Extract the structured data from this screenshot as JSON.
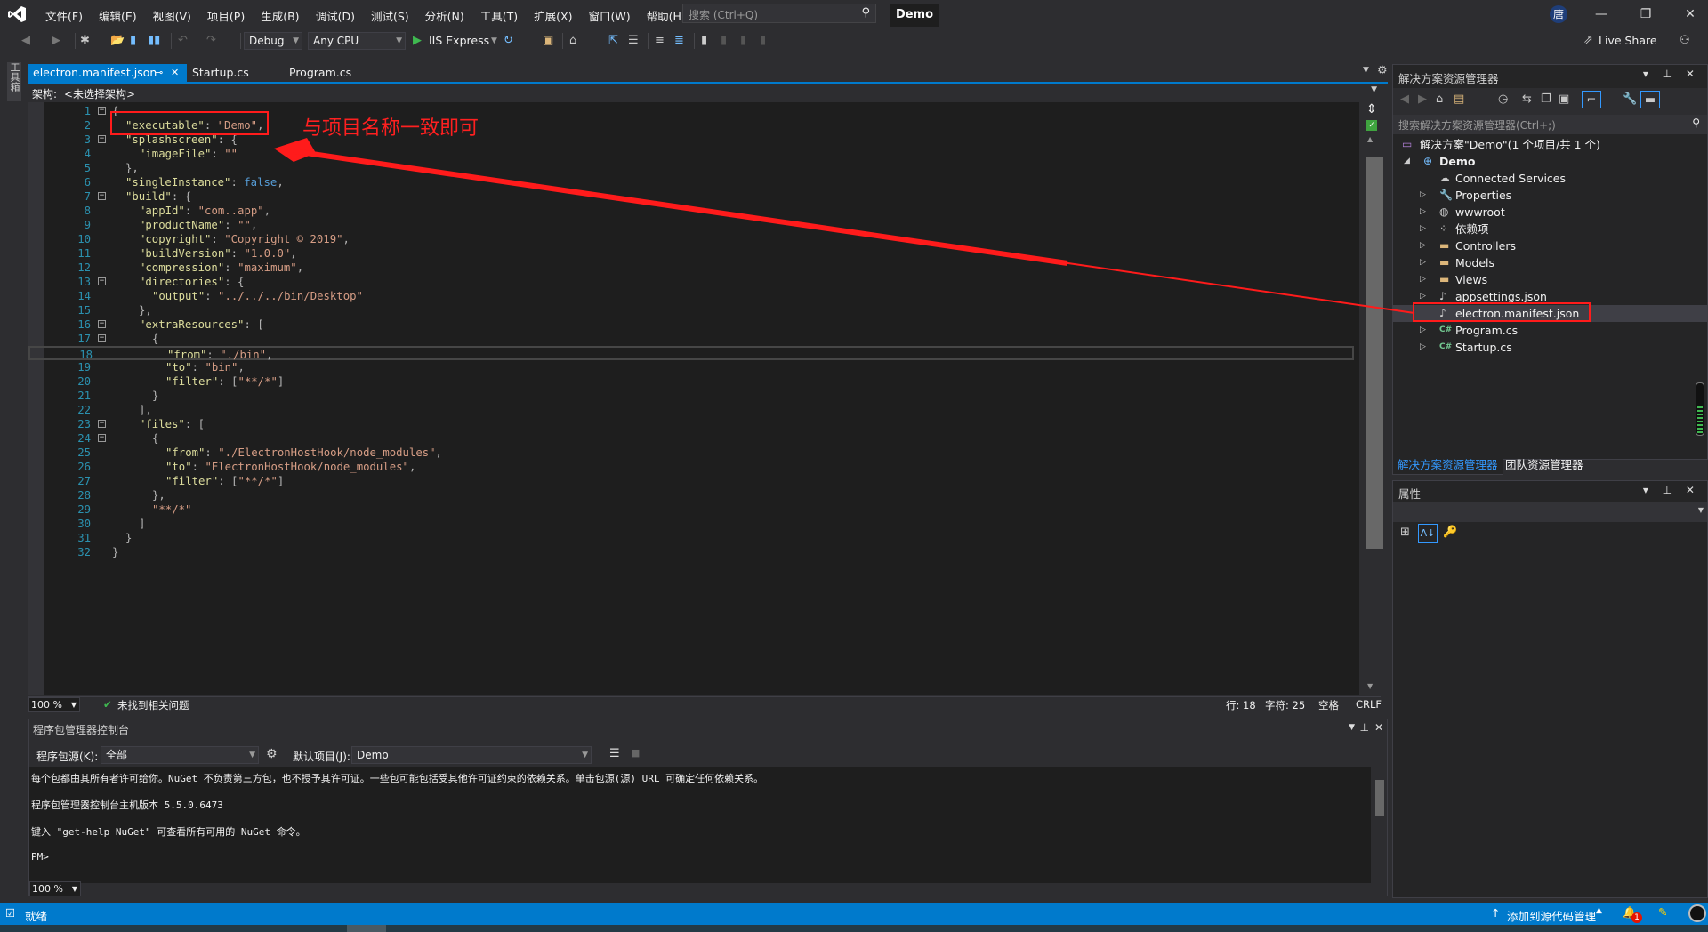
{
  "titlebar": {
    "menus": [
      "文件(F)",
      "编辑(E)",
      "视图(V)",
      "项目(P)",
      "生成(B)",
      "调试(D)",
      "测试(S)",
      "分析(N)",
      "工具(T)",
      "扩展(X)",
      "窗口(W)",
      "帮助(H)"
    ],
    "search_placeholder": "搜索 (Ctrl+Q)",
    "project_name": "Demo",
    "avatar_initial": "唐"
  },
  "toolbar": {
    "config": "Debug",
    "platform": "Any CPU",
    "run_target": "IIS Express",
    "live_share": "Live Share"
  },
  "left_strip": {
    "toolbox_label": "工具箱"
  },
  "tabs": [
    {
      "label": "electron.manifest.json",
      "active": true
    },
    {
      "label": "Startup.cs",
      "active": false
    },
    {
      "label": "Program.cs",
      "active": false
    }
  ],
  "navbar": {
    "label": "架构:",
    "value": "<未选择架构>"
  },
  "editor": {
    "lines": [
      {
        "n": 1,
        "indent": 0,
        "fold": true,
        "tokens": [
          [
            "p",
            "{"
          ]
        ]
      },
      {
        "n": 2,
        "indent": 1,
        "tokens": [
          [
            "k",
            "\"executable\""
          ],
          [
            "p",
            ": "
          ],
          [
            "s",
            "\"Demo\""
          ],
          [
            "p",
            ","
          ]
        ]
      },
      {
        "n": 3,
        "indent": 1,
        "fold": true,
        "tokens": [
          [
            "k",
            "\"splashscreen\""
          ],
          [
            "p",
            ": {"
          ]
        ]
      },
      {
        "n": 4,
        "indent": 2,
        "tokens": [
          [
            "k",
            "\"imageFile\""
          ],
          [
            "p",
            ": "
          ],
          [
            "s",
            "\"\""
          ]
        ]
      },
      {
        "n": 5,
        "indent": 1,
        "tokens": [
          [
            "p",
            "},"
          ]
        ]
      },
      {
        "n": 6,
        "indent": 1,
        "tokens": [
          [
            "k",
            "\"singleInstance\""
          ],
          [
            "p",
            ": "
          ],
          [
            "b",
            "false"
          ],
          [
            "p",
            ","
          ]
        ]
      },
      {
        "n": 7,
        "indent": 1,
        "fold": true,
        "tokens": [
          [
            "k",
            "\"build\""
          ],
          [
            "p",
            ": {"
          ]
        ]
      },
      {
        "n": 8,
        "indent": 2,
        "tokens": [
          [
            "k",
            "\"appId\""
          ],
          [
            "p",
            ": "
          ],
          [
            "s",
            "\"com..app\""
          ],
          [
            "p",
            ","
          ]
        ]
      },
      {
        "n": 9,
        "indent": 2,
        "tokens": [
          [
            "k",
            "\"productName\""
          ],
          [
            "p",
            ": "
          ],
          [
            "s",
            "\"\""
          ],
          [
            "p",
            ","
          ]
        ]
      },
      {
        "n": 10,
        "indent": 2,
        "tokens": [
          [
            "k",
            "\"copyright\""
          ],
          [
            "p",
            ": "
          ],
          [
            "s",
            "\"Copyright © 2019\""
          ],
          [
            "p",
            ","
          ]
        ]
      },
      {
        "n": 11,
        "indent": 2,
        "tokens": [
          [
            "k",
            "\"buildVersion\""
          ],
          [
            "p",
            ": "
          ],
          [
            "s",
            "\"1.0.0\""
          ],
          [
            "p",
            ","
          ]
        ]
      },
      {
        "n": 12,
        "indent": 2,
        "tokens": [
          [
            "k",
            "\"compression\""
          ],
          [
            "p",
            ": "
          ],
          [
            "s",
            "\"maximum\""
          ],
          [
            "p",
            ","
          ]
        ]
      },
      {
        "n": 13,
        "indent": 2,
        "fold": true,
        "tokens": [
          [
            "k",
            "\"directories\""
          ],
          [
            "p",
            ": {"
          ]
        ]
      },
      {
        "n": 14,
        "indent": 3,
        "tokens": [
          [
            "k",
            "\"output\""
          ],
          [
            "p",
            ": "
          ],
          [
            "s",
            "\"../../../bin/Desktop\""
          ]
        ]
      },
      {
        "n": 15,
        "indent": 2,
        "tokens": [
          [
            "p",
            "},"
          ]
        ]
      },
      {
        "n": 16,
        "indent": 2,
        "fold": true,
        "tokens": [
          [
            "k",
            "\"extraResources\""
          ],
          [
            "p",
            ": ["
          ]
        ]
      },
      {
        "n": 17,
        "indent": 3,
        "fold": true,
        "tokens": [
          [
            "p",
            "{"
          ]
        ]
      },
      {
        "n": 18,
        "indent": 4,
        "current": true,
        "tokens": [
          [
            "k",
            "\"from\""
          ],
          [
            "p",
            ": "
          ],
          [
            "s",
            "\"./bin\""
          ],
          [
            "p",
            ","
          ]
        ]
      },
      {
        "n": 19,
        "indent": 4,
        "tokens": [
          [
            "k",
            "\"to\""
          ],
          [
            "p",
            ": "
          ],
          [
            "s",
            "\"bin\""
          ],
          [
            "p",
            ","
          ]
        ]
      },
      {
        "n": 20,
        "indent": 4,
        "tokens": [
          [
            "k",
            "\"filter\""
          ],
          [
            "p",
            ": ["
          ],
          [
            "s",
            "\"**/*\""
          ],
          [
            "p",
            "]"
          ]
        ]
      },
      {
        "n": 21,
        "indent": 3,
        "tokens": [
          [
            "p",
            "}"
          ]
        ]
      },
      {
        "n": 22,
        "indent": 2,
        "tokens": [
          [
            "p",
            "],"
          ]
        ]
      },
      {
        "n": 23,
        "indent": 2,
        "fold": true,
        "tokens": [
          [
            "k",
            "\"files\""
          ],
          [
            "p",
            ": ["
          ]
        ]
      },
      {
        "n": 24,
        "indent": 3,
        "fold": true,
        "tokens": [
          [
            "p",
            "{"
          ]
        ]
      },
      {
        "n": 25,
        "indent": 4,
        "tokens": [
          [
            "k",
            "\"from\""
          ],
          [
            "p",
            ": "
          ],
          [
            "s",
            "\"./ElectronHostHook/node_modules\""
          ],
          [
            "p",
            ","
          ]
        ]
      },
      {
        "n": 26,
        "indent": 4,
        "tokens": [
          [
            "k",
            "\"to\""
          ],
          [
            "p",
            ": "
          ],
          [
            "s",
            "\"ElectronHostHook/node_modules\""
          ],
          [
            "p",
            ","
          ]
        ]
      },
      {
        "n": 27,
        "indent": 4,
        "tokens": [
          [
            "k",
            "\"filter\""
          ],
          [
            "p",
            ": ["
          ],
          [
            "s",
            "\"**/*\""
          ],
          [
            "p",
            "]"
          ]
        ]
      },
      {
        "n": 28,
        "indent": 3,
        "tokens": [
          [
            "p",
            "},"
          ]
        ]
      },
      {
        "n": 29,
        "indent": 3,
        "tokens": [
          [
            "s",
            "\"**/*\""
          ]
        ]
      },
      {
        "n": 30,
        "indent": 2,
        "tokens": [
          [
            "p",
            "]"
          ]
        ]
      },
      {
        "n": 31,
        "indent": 1,
        "tokens": [
          [
            "p",
            "}"
          ]
        ]
      },
      {
        "n": 32,
        "indent": 0,
        "tokens": [
          [
            "p",
            "}"
          ]
        ]
      }
    ]
  },
  "annotation": {
    "text": "与项目名称一致即可",
    "color": "#ff1b1b"
  },
  "editor_status": {
    "zoom": "100 %",
    "issues": "未找到相关问题",
    "line": "行: 18",
    "char": "字符: 25",
    "whitespace": "空格",
    "eol": "CRLF"
  },
  "package_console": {
    "title": "程序包管理器控制台",
    "source_label": "程序包源(K):",
    "source_value": "全部",
    "project_label": "默认项目(J):",
    "project_value": "Demo",
    "output": [
      "每个包都由其所有者许可给你。NuGet 不负责第三方包，也不授予其许可证。一些包可能包括受其他许可证约束的依赖关系。单击包源(源) URL 可确定任何依赖关系。",
      "程序包管理器控制台主机版本 5.5.0.6473",
      "键入 \"get-help NuGet\" 可查看所有可用的 NuGet 命令。",
      "PM>"
    ],
    "zoom": "100 %"
  },
  "solution_explorer": {
    "title": "解决方案资源管理器",
    "search_placeholder": "搜索解决方案资源管理器(Ctrl+;)",
    "tree": [
      {
        "label": "解决方案\"Demo\"(1 个项目/共 1 个)",
        "level": 0,
        "icon": "solution-icon",
        "arrow": ""
      },
      {
        "label": "Demo",
        "level": 1,
        "icon": "web-project-icon",
        "arrow": "expanded",
        "bold": true
      },
      {
        "label": "Connected Services",
        "level": 2,
        "icon": "cloud-icon",
        "arrow": ""
      },
      {
        "label": "Properties",
        "level": 2,
        "icon": "wrench-icon",
        "arrow": "collapsed"
      },
      {
        "label": "wwwroot",
        "level": 2,
        "icon": "globe-icon",
        "arrow": "collapsed"
      },
      {
        "label": "依赖项",
        "level": 2,
        "icon": "dependencies-icon",
        "arrow": "collapsed"
      },
      {
        "label": "Controllers",
        "level": 2,
        "icon": "folder-icon",
        "arrow": "collapsed"
      },
      {
        "label": "Models",
        "level": 2,
        "icon": "folder-icon",
        "arrow": "collapsed"
      },
      {
        "label": "Views",
        "level": 2,
        "icon": "folder-icon",
        "arrow": "collapsed"
      },
      {
        "label": "appsettings.json",
        "level": 2,
        "icon": "json-file-icon",
        "arrow": "collapsed"
      },
      {
        "label": "electron.manifest.json",
        "level": 2,
        "icon": "json-file-icon",
        "arrow": "",
        "selected": true
      },
      {
        "label": "Program.cs",
        "level": 2,
        "icon": "csharp-file-icon",
        "arrow": "collapsed"
      },
      {
        "label": "Startup.cs",
        "level": 2,
        "icon": "csharp-file-icon",
        "arrow": "collapsed"
      }
    ],
    "tabs": [
      "解决方案资源管理器",
      "团队资源管理器"
    ]
  },
  "properties": {
    "title": "属性"
  },
  "statusbar": {
    "ready": "就绪",
    "source_control": "添加到源代码管理",
    "notification_count": "1"
  },
  "colors": {
    "accent": "#007acc",
    "annotation": "#ff1b1b"
  }
}
